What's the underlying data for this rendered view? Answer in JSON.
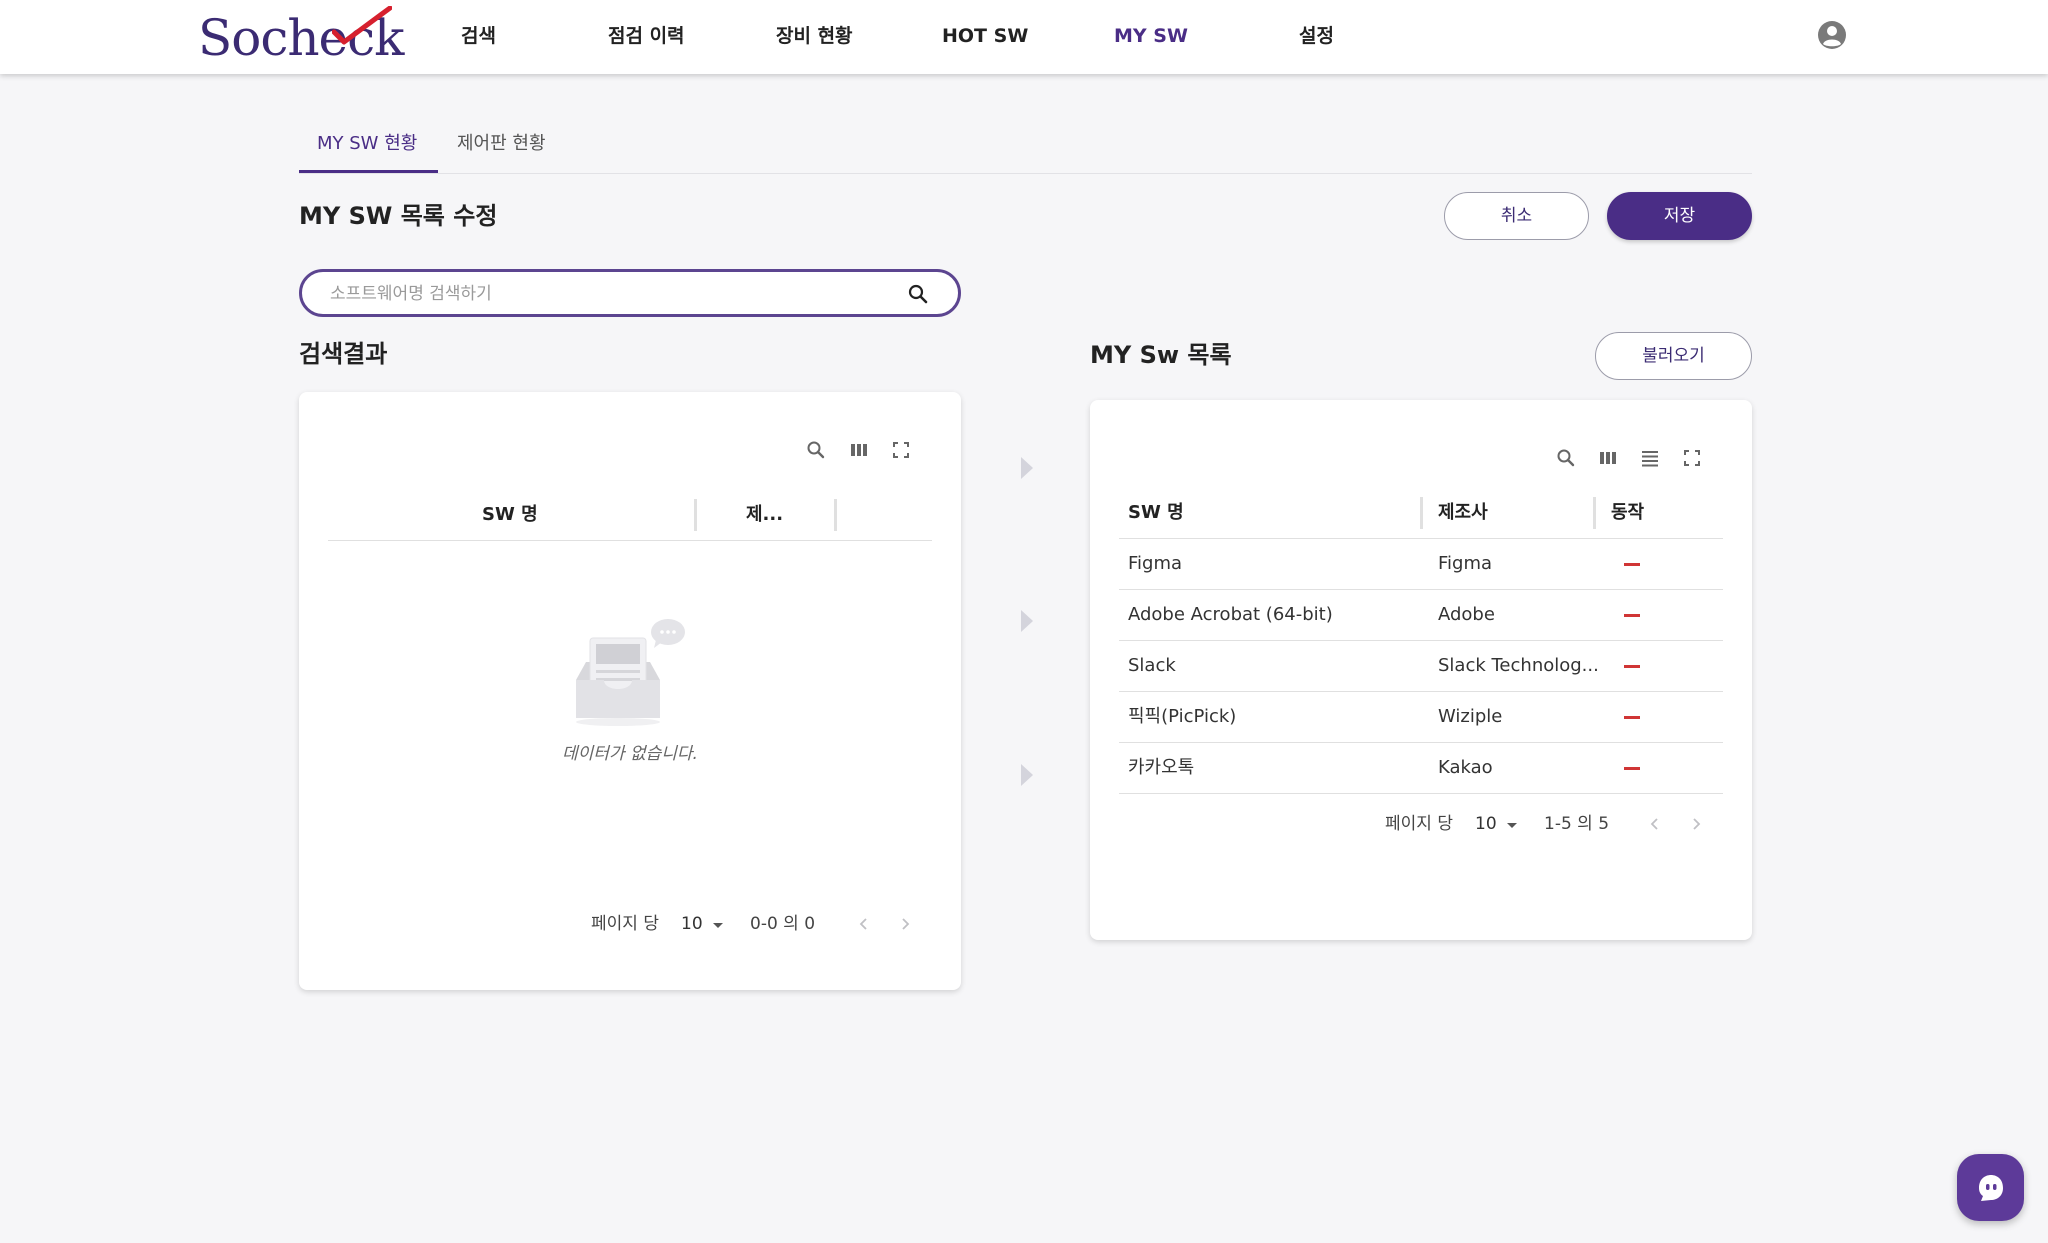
{
  "header": {
    "logo_text": "Socheck",
    "nav": [
      "검색",
      "점검 이력",
      "장비 현황",
      "HOT SW",
      "MY SW",
      "설정"
    ],
    "active_nav": "MY SW"
  },
  "tabs": [
    "MY SW 현황",
    "제어판 현황"
  ],
  "page_title": "MY SW 목록 수정",
  "buttons": {
    "cancel": "취소",
    "save": "저장",
    "load": "불러오기"
  },
  "search": {
    "placeholder": "소프트웨어명 검색하기",
    "value": ""
  },
  "results": {
    "title": "검색결과",
    "columns": [
      "SW 명",
      "제..."
    ],
    "empty_text": "데이터가 없습니다.",
    "pager": {
      "label": "페이지 당",
      "per_page": "10",
      "range": "0-0 의 0"
    }
  },
  "my_list": {
    "title": "MY Sw 목록",
    "columns": [
      "SW 명",
      "제조사",
      "동작"
    ],
    "rows": [
      {
        "name": "Figma",
        "vendor": "Figma"
      },
      {
        "name": "Adobe Acrobat (64-bit)",
        "vendor": "Adobe"
      },
      {
        "name": "Slack",
        "vendor": "Slack Technolog..."
      },
      {
        "name": "픽픽(PicPick)",
        "vendor": "Wiziple"
      },
      {
        "name": "카카오톡",
        "vendor": "Kakao"
      }
    ],
    "pager": {
      "label": "페이지 당",
      "per_page": "10",
      "range": "1-5 의 5"
    }
  },
  "colors": {
    "accent": "#4a2d86",
    "remove": "#d03535",
    "chat": "#5d3a99"
  },
  "icons": [
    "check-mark-icon",
    "user-icon",
    "search-icon",
    "column-icon",
    "density-icon",
    "fullscreen-icon",
    "remove-icon",
    "chevron-left-icon",
    "chevron-right-icon",
    "caret-down-icon",
    "transfer-arrow-icon",
    "chat-icon"
  ]
}
